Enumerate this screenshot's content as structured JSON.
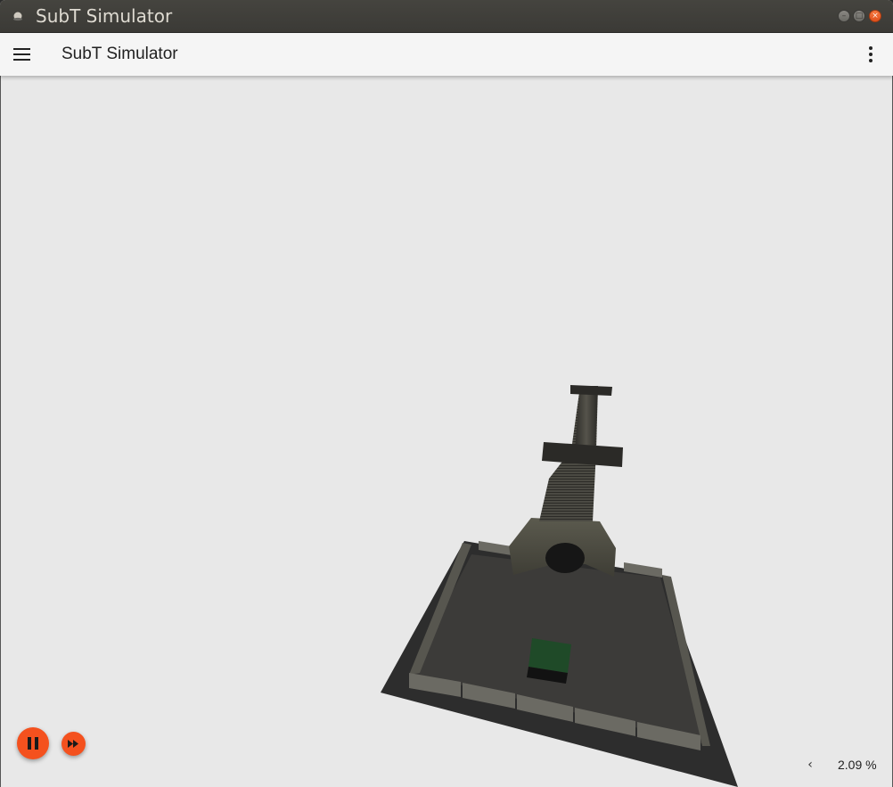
{
  "window": {
    "title": "SubT Simulator"
  },
  "appbar": {
    "title": "SubT Simulator"
  },
  "icons": {
    "app": "app-icon",
    "menu": "hamburger-menu-icon",
    "more": "more-vert-icon",
    "pause": "pause-icon",
    "step": "fast-forward-icon",
    "expand": "chevron-left-icon"
  },
  "playback": {
    "real_time_factor": "2.09 %",
    "expand_label": "‹"
  },
  "colors": {
    "accent": "#f4511e",
    "titlebar": "#3b3a36",
    "appbar": "#f5f5f5",
    "scene_background": "#e8e8e8",
    "close_button": "#e9541d"
  }
}
